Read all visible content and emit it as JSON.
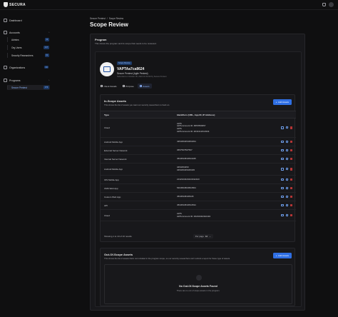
{
  "brand": {
    "name": "SECURA"
  },
  "sidebar": {
    "dashboard": "Dashboard",
    "accounts": {
      "label": "Accounts",
      "items": [
        {
          "label": "Admins",
          "count": "11"
        },
        {
          "label": "Org Users",
          "count": "217"
        },
        {
          "label": "Security Researchers",
          "count": "61"
        }
      ]
    },
    "organizations": {
      "label": "Organizations",
      "count": "33"
    },
    "programs": {
      "label": "Programs",
      "items": [
        {
          "label": "Secure Pentest",
          "count": "376"
        }
      ]
    }
  },
  "breadcrumb": {
    "root": "Secure Pentest",
    "sep": "/",
    "current": "Scope Review"
  },
  "page": {
    "title": "Scope Review"
  },
  "program_card": {
    "title": "Program",
    "subtitle": "This shows the program and its scope that needs to be reviewed.",
    "pill": "Scope Review",
    "id": "VAPTAa7ca8624",
    "name": "Secure Pentest (Agile Pentest)",
    "meta": "Submitted on October 30, 2024 11:03 AM by Secure Pentest"
  },
  "tabs": [
    {
      "label": "Client Details"
    },
    {
      "label": "Purpose"
    },
    {
      "label": "Assets"
    }
  ],
  "in_scope": {
    "title": "In-Scope Assets",
    "subtitle": "This shows the list of assets you want our security researchers to hack on.",
    "add_label": "Add Assets",
    "columns": [
      "Type",
      "Identifiers (URL, App ID, IP Address)"
    ],
    "rows": [
      {
        "type": "Cloud",
        "id1": "AWS",
        "id2": "AWS Account ID: #957860957",
        "id3": "AWS",
        "id4": "AWS Account ID: #231312313334"
      },
      {
        "type": "Android Mobile App",
        "id1": "4354353454353454"
      },
      {
        "type": "External Server Network",
        "id1": "3657567567567"
      },
      {
        "type": "Internal Server Network",
        "id1": "4534534534534345"
      },
      {
        "type": "Android Mobile App",
        "id1": "3453453453",
        "id2": "345345345345345"
      },
      {
        "type": "IOS Mobile App",
        "id1": "2132323423423432423"
      },
      {
        "type": "CMS Web App",
        "id1": "5464564564564564"
      },
      {
        "type": "Custom Web App",
        "id1": "45345345345345"
      },
      {
        "type": "API",
        "id1": "4534534534534534"
      },
      {
        "type": "Cloud",
        "id1": "AWS",
        "id2": "AWS Account ID: #4234342342434"
      }
    ],
    "pager": {
      "showing": "Showing 1 to 10 of 10 results",
      "per_page": "Per page",
      "per_page_value": "10"
    }
  },
  "out_scope": {
    "title": "Out-Of-Scope Assets",
    "subtitle": "This shows the list of assets that's not included in the program scope, so our security researchers can't submit a report for these type of assets.",
    "add_label": "Add Assets",
    "empty_title": "No Out-Of-Scope Assets Found",
    "empty_sub": "There are no out of scope assets in the program."
  }
}
